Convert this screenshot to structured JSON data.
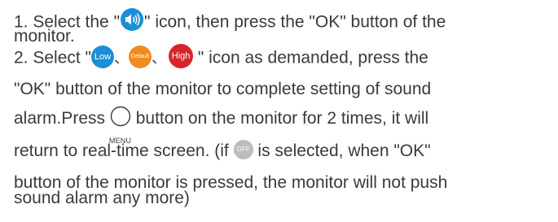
{
  "colors": {
    "text": "#3a3a3a",
    "sound_icon": "#1a8fd6",
    "low": "#1a8fd6",
    "default": "#f08c1e",
    "high": "#d9232a",
    "off": "#bdbdbd"
  },
  "line1": {
    "a": "1. Select the \"",
    "b": "\" icon, then press the \"OK\" button of the"
  },
  "line2": "monitor.",
  "line3": {
    "a": "2. Select \"",
    "low": "Low",
    "sep1": "、",
    "default": "Default",
    "sep2": "、",
    "high": "High",
    "b": " \" icon as demanded, press the"
  },
  "line4": "\"OK\" button of the monitor to complete setting of sound",
  "line5": {
    "a": "alarm.Press",
    "menu_label": "MENU",
    "b": " button on the monitor for 2 times, it will"
  },
  "line6": {
    "a": "return to real-time screen. (if ",
    "off": "OFF",
    "b": " is selected, when \"OK\""
  },
  "line7": "button of the monitor is pressed, the monitor will not push",
  "line8": "sound alarm any more)"
}
